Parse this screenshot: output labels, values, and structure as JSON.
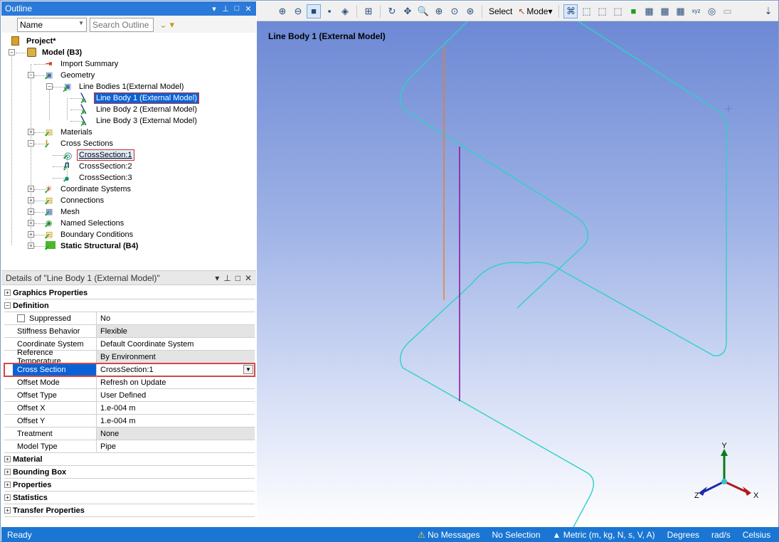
{
  "outline": {
    "title": "Outline",
    "controls": [
      "▾",
      "⊥",
      "□",
      "✕"
    ],
    "name_combo": "Name",
    "search_placeholder": "Search Outline"
  },
  "tree": [
    {
      "label": "Project*",
      "bold": true,
      "icon": "project-icon"
    },
    {
      "label": "Model (B3)",
      "bold": true,
      "icon": "model-icon"
    },
    {
      "label": "Import Summary",
      "icon": "import-summary-icon"
    },
    {
      "label": "Geometry",
      "icon": "geometry-icon"
    },
    {
      "label": "Line Bodies 1(External Model)",
      "icon": "line-bodies-icon"
    },
    {
      "label": "Line Body 1 (External Model)",
      "icon": "line-body-icon",
      "selected": true
    },
    {
      "label": "Line Body 2 (External Model)",
      "icon": "line-body-icon"
    },
    {
      "label": "Line Body 3 (External Model)",
      "icon": "line-body-icon"
    },
    {
      "label": "Materials",
      "icon": "materials-icon"
    },
    {
      "label": "Cross Sections",
      "icon": "cross-sections-icon"
    },
    {
      "label": "CrossSection:1",
      "icon": "pipe-section-icon",
      "highlight": true
    },
    {
      "label": "CrossSection:2",
      "icon": "hat-section-icon"
    },
    {
      "label": "CrossSection:3",
      "icon": "circle-section-icon"
    },
    {
      "label": "Coordinate Systems",
      "icon": "coordinate-systems-icon"
    },
    {
      "label": "Connections",
      "icon": "connections-icon"
    },
    {
      "label": "Mesh",
      "icon": "mesh-icon"
    },
    {
      "label": "Named Selections",
      "icon": "named-selections-icon"
    },
    {
      "label": "Boundary Conditions",
      "icon": "boundary-conditions-icon"
    },
    {
      "label": "Static Structural (B4)",
      "bold": true,
      "icon": "static-structural-icon"
    }
  ],
  "details": {
    "title": "Details of \"Line Body 1 (External Model)\"",
    "groups": {
      "graphics": "Graphics Properties",
      "definition": "Definition",
      "material": "Material",
      "bounding_box": "Bounding Box",
      "properties": "Properties",
      "statistics": "Statistics",
      "transfer": "Transfer Properties"
    },
    "rows": [
      {
        "key": "Suppressed",
        "value": "No",
        "checkbox": true
      },
      {
        "key": "Stiffness Behavior",
        "value": "Flexible",
        "shade": true
      },
      {
        "key": "Coordinate System",
        "value": "Default Coordinate System"
      },
      {
        "key": "Reference Temperature",
        "value": "By Environment",
        "shade": true
      },
      {
        "key": "Cross Section",
        "value": "CrossSection:1",
        "selected": true
      },
      {
        "key": "Offset Mode",
        "value": "Refresh on Update"
      },
      {
        "key": "Offset Type",
        "value": "User Defined"
      },
      {
        "key": "Offset X",
        "value": "1.e-004 m"
      },
      {
        "key": "Offset Y",
        "value": "1.e-004 m"
      },
      {
        "key": "Treatment",
        "value": "None",
        "shade": true
      },
      {
        "key": "Model Type",
        "value": "Pipe"
      }
    ]
  },
  "toolbar": {
    "select_label": "Select",
    "mode_label": "Mode"
  },
  "viewport": {
    "label": "Line Body 1 (External Model)",
    "triad": {
      "x": "X",
      "y": "Y",
      "z": "Z"
    },
    "colors": {
      "body_line": "#2ed1c8",
      "highlight_line": "#8a1ca0",
      "orange_line": "#f07a1e"
    }
  },
  "status": {
    "ready": "Ready",
    "messages": "No Messages",
    "selection": "No Selection",
    "units": "Metric (m, kg, N, s, V, A)",
    "angle": "Degrees",
    "angular_velocity": "rad/s",
    "temperature": "Celsius"
  }
}
